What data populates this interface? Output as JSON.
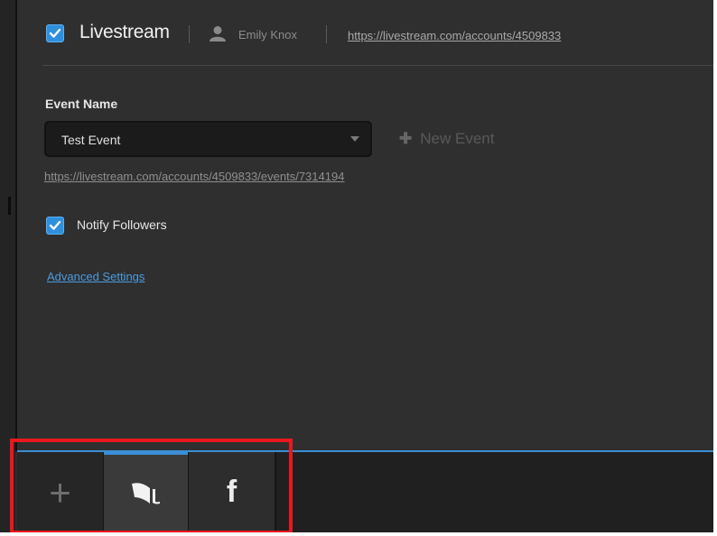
{
  "header": {
    "service_checked": true,
    "service_name": "Livestream",
    "user_icon": "user-icon",
    "user_name": "Emily Knox",
    "account_url": "https://livestream.com/accounts/4509833"
  },
  "event": {
    "field_label": "Event Name",
    "selected_event": "Test Event",
    "new_event_label": "New Event",
    "new_event_icon": "plus-icon",
    "event_url": "https://livestream.com/accounts/4509833/events/7314194"
  },
  "notify": {
    "checked": true,
    "label": "Notify Followers"
  },
  "advanced_link": "Advanced Settings",
  "tabs": [
    {
      "icon": "plus-icon",
      "glyph": "+",
      "label": "Add service",
      "active": false
    },
    {
      "icon": "livestream-icon",
      "label": "Livestream",
      "active": true
    },
    {
      "icon": "facebook-icon",
      "glyph": "f",
      "label": "Facebook",
      "active": false
    }
  ],
  "colors": {
    "accent": "#2e8fdc",
    "highlight": "#e8181e",
    "background": "#2f2f2f"
  }
}
